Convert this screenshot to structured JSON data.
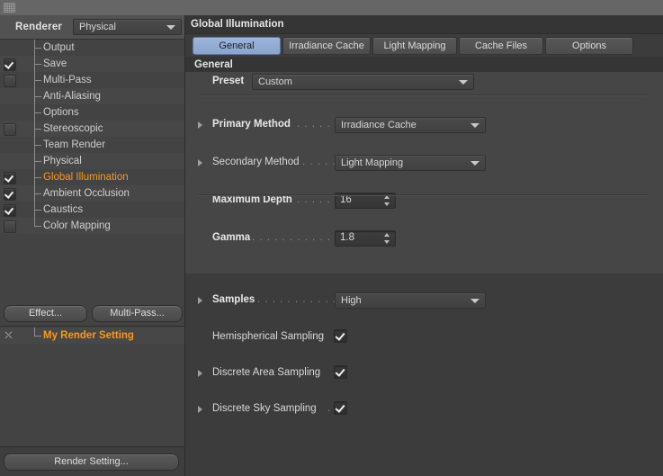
{
  "window": {
    "grip_icon": "grip-dots-icon"
  },
  "sidebar": {
    "renderer_label": "Renderer",
    "renderer_value": "Physical",
    "items": [
      {
        "label": "Output",
        "checkbox": "none",
        "selected": false
      },
      {
        "label": "Save",
        "checkbox": "checked",
        "selected": false
      },
      {
        "label": "Multi-Pass",
        "checkbox": "unchecked",
        "selected": false
      },
      {
        "label": "Anti-Aliasing",
        "checkbox": "none",
        "selected": false
      },
      {
        "label": "Options",
        "checkbox": "none",
        "selected": false
      },
      {
        "label": "Stereoscopic",
        "checkbox": "unchecked",
        "selected": false
      },
      {
        "label": "Team Render",
        "checkbox": "none",
        "selected": false
      },
      {
        "label": "Physical",
        "checkbox": "none",
        "selected": false
      },
      {
        "label": "Global Illumination",
        "checkbox": "checked",
        "selected": true
      },
      {
        "label": "Ambient Occlusion",
        "checkbox": "checked",
        "selected": false
      },
      {
        "label": "Caustics",
        "checkbox": "checked",
        "selected": false
      },
      {
        "label": "Color Mapping",
        "checkbox": "unchecked",
        "selected": false
      }
    ],
    "effect_button": "Effect...",
    "multipass_button": "Multi-Pass...",
    "render_setting_name": "My Render Setting",
    "render_setting_icon": "render-setting-icon",
    "render_setting_button": "Render Setting..."
  },
  "panel": {
    "title": "Global Illumination",
    "tabs": [
      {
        "label": "General",
        "active": true
      },
      {
        "label": "Irradiance Cache",
        "active": false
      },
      {
        "label": "Light Mapping",
        "active": false
      },
      {
        "label": "Cache Files",
        "active": false
      },
      {
        "label": "Options",
        "active": false
      }
    ],
    "group_header": "General",
    "fields": {
      "preset_label": "Preset",
      "preset_value": "Custom",
      "primary_method_label": "Primary Method",
      "primary_method_dots": ". . . . . .",
      "primary_method_value": "Irradiance Cache",
      "secondary_method_label": "Secondary Method",
      "secondary_method_dots": ". . . . . .",
      "secondary_method_value": "Light Mapping",
      "maximum_depth_label": "Maximum Depth",
      "maximum_depth_dots": ". . . . . .",
      "maximum_depth_value": "16",
      "gamma_label": "Gamma",
      "gamma_dots": ". . . . . . . . . . . . .",
      "gamma_value": "1.8",
      "samples_label": "Samples",
      "samples_dots": ". . . . . . . . . . . .",
      "samples_value": "High",
      "hemispherical_label": "Hemispherical Sampling",
      "hemispherical_checked": true,
      "discrete_area_label": "Discrete Area Sampling",
      "discrete_area_checked": true,
      "discrete_sky_label": "Discrete Sky Sampling",
      "discrete_sky_dots": ".",
      "discrete_sky_checked": true
    }
  },
  "colors": {
    "accent_orange": "#f79a1e",
    "tab_active_blue": "#8aa4cd",
    "panel_bg": "#464646",
    "sidebar_bg": "#434343"
  }
}
